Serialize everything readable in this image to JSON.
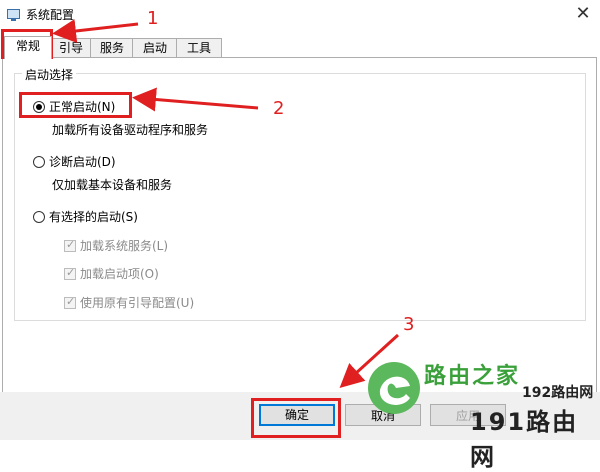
{
  "window": {
    "title": "系统配置"
  },
  "tabs": [
    {
      "label": "常规"
    },
    {
      "label": "引导"
    },
    {
      "label": "服务"
    },
    {
      "label": "启动"
    },
    {
      "label": "工具"
    }
  ],
  "startup": {
    "group_label": "启动选择",
    "options": [
      {
        "label": "正常启动(N)",
        "desc": "加载所有设备驱动程序和服务",
        "selected": true
      },
      {
        "label": "诊断启动(D)",
        "desc": "仅加载基本设备和服务",
        "selected": false
      },
      {
        "label": "有选择的启动(S)",
        "selected": false
      }
    ],
    "checks": [
      {
        "label": "加载系统服务(L)",
        "checked": true
      },
      {
        "label": "加载启动项(O)",
        "checked": true
      },
      {
        "label": "使用原有引导配置(U)",
        "checked": true
      }
    ]
  },
  "buttons": {
    "ok": "确定",
    "cancel": "取消",
    "apply": "应用"
  },
  "callouts": [
    "1",
    "2",
    "3"
  ],
  "watermark": {
    "brand": "路由之家",
    "site1": "192路由网",
    "site2": "191路由网"
  },
  "colors": {
    "annotation": "#e02020",
    "accent": "#0078d7",
    "brand_green": "#3aa03a"
  }
}
